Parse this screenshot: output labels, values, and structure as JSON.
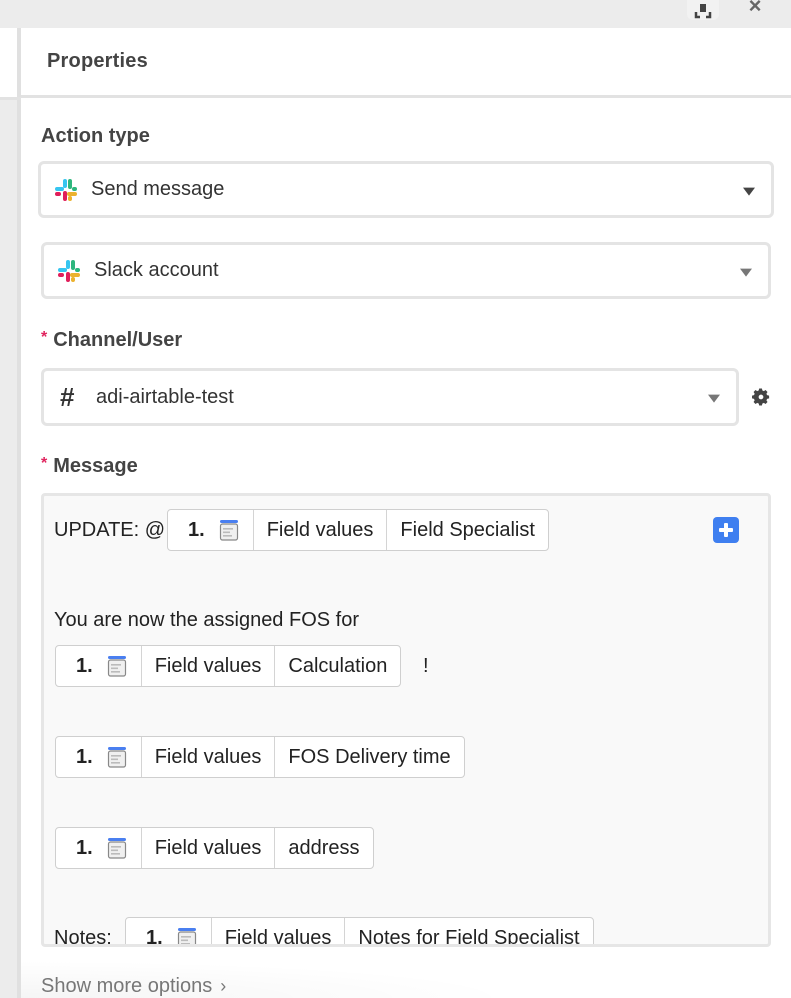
{
  "window": {
    "capture_icon": "screenshot-capture-icon",
    "close_icon": "close-icon",
    "close_glyph": "×"
  },
  "panel": {
    "title": "Properties"
  },
  "action_type": {
    "label": "Action type",
    "value": "Send message",
    "icon": "slack-icon"
  },
  "account": {
    "value": "Slack account",
    "icon": "slack-icon"
  },
  "channel": {
    "required_mark": "*",
    "label": "Channel/User",
    "hash_glyph": "#",
    "value": "adi-airtable-test",
    "settings_icon": "gear-icon"
  },
  "message": {
    "required_mark": "*",
    "label": "Message",
    "lines": {
      "update_prefix": "UPDATE: @",
      "assigned_text": "You are now the assigned FOS for",
      "exclaim": "!",
      "notes_prefix": "Notes:"
    },
    "tokens": [
      {
        "step": "1.",
        "source": "Field values",
        "field": "Field Specialist"
      },
      {
        "step": "1.",
        "source": "Field values",
        "field": "Calculation"
      },
      {
        "step": "1.",
        "source": "Field values",
        "field": "FOS Delivery time"
      },
      {
        "step": "1.",
        "source": "Field values",
        "field": "address"
      },
      {
        "step": "1.",
        "source": "Field values",
        "field": "Notes for Field Specialist"
      }
    ],
    "insert_icon": "plus-icon"
  },
  "footer": {
    "show_more": "Show more options",
    "chevron": "›"
  },
  "colors": {
    "accent": "#3f7ff0",
    "required": "#e0245e",
    "slack_blue": "#36c5f0",
    "slack_green": "#2eb67d",
    "slack_yellow": "#ecb22e",
    "slack_red": "#e01e5a"
  }
}
